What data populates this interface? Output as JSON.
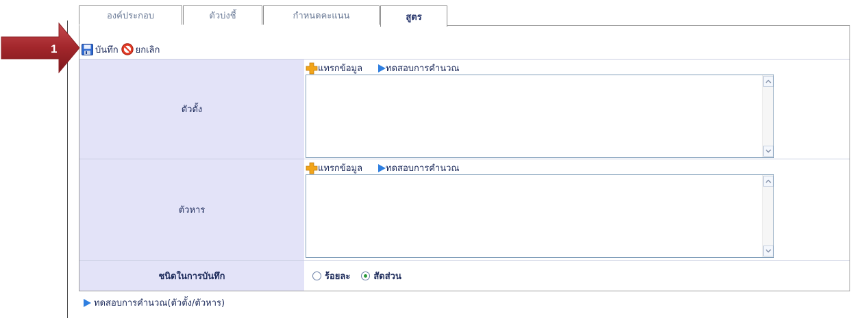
{
  "tabs": [
    {
      "label": "องค์ประกอบ",
      "active": false
    },
    {
      "label": "ตัวบ่งชี้",
      "active": false
    },
    {
      "label": "กำหนดคะแนน",
      "active": false
    },
    {
      "label": "สูตร",
      "active": true
    }
  ],
  "callout": {
    "number": "1",
    "color": "#a2262b"
  },
  "toolbar": {
    "save_label": "บันทึก",
    "cancel_label": "ยกเลิก",
    "save_icon": "floppy-disk-icon",
    "cancel_icon": "no-entry-icon"
  },
  "rows": {
    "numerator": {
      "label": "ตัวตั้ง",
      "insert_label": "แทรกข้อมูล",
      "test_label": "ทดสอบการคำนวณ",
      "value": ""
    },
    "denominator": {
      "label": "ตัวหาร",
      "insert_label": "แทรกข้อมูล",
      "test_label": "ทดสอบการคำนวณ",
      "value": ""
    },
    "record_type": {
      "label": "ชนิดในการบันทึก",
      "options": [
        {
          "label": "ร้อยละ",
          "selected": false
        },
        {
          "label": "สัดส่วน",
          "selected": true
        }
      ]
    }
  },
  "bottom_link": {
    "label": "ทดสอบการคำนวณ(ตัวตั้ง/ตัวหาร)"
  },
  "colors": {
    "label_bg": "#e3e3f8",
    "text": "#1c2a5a",
    "link_arrow": "#2f7fe0",
    "plus_icon": "#f2a51a",
    "radio_selected": "#2a9a3a"
  }
}
